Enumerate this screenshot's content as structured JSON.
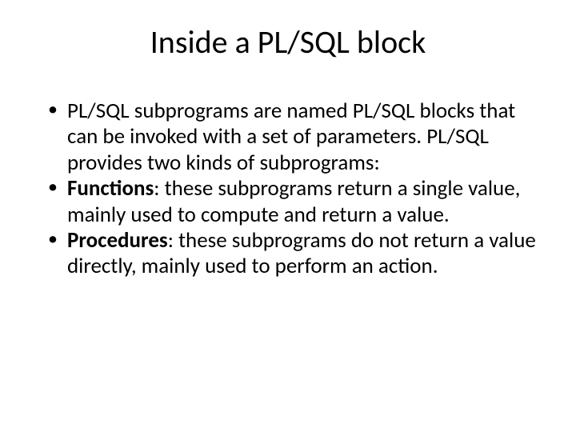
{
  "title": "Inside a PL/SQL block",
  "items": [
    {
      "prefix": "",
      "boldPart": "",
      "rest": "PL/SQL subprograms are named PL/SQL blocks that can be invoked with a set of parameters. PL/SQL provides two kinds of subprograms:"
    },
    {
      "prefix": "",
      "boldPart": "Functions",
      "rest": ": these subprograms return a single value, mainly used to compute and return a value."
    },
    {
      "prefix": "",
      "boldPart": "Procedures",
      "rest": ": these subprograms do not return a value directly, mainly used to perform an action."
    }
  ]
}
